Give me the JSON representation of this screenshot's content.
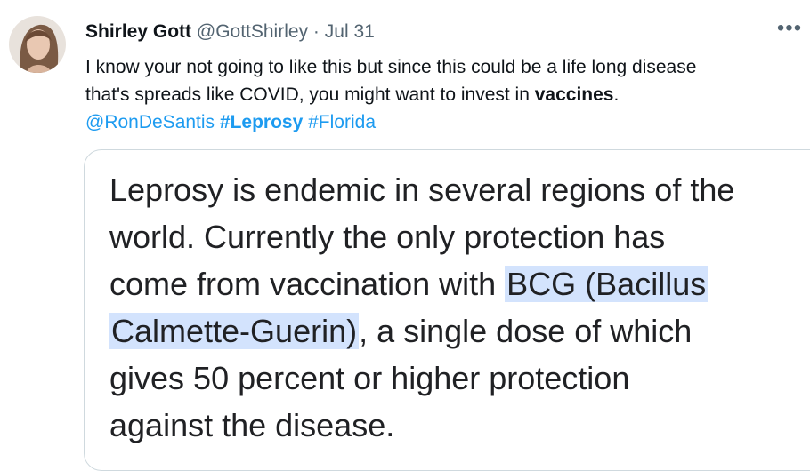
{
  "tweet": {
    "author_name": "Shirley Gott",
    "handle": "@GottShirley",
    "separator": "·",
    "date": "Jul 31",
    "more_icon": "more-horizontal-icon",
    "text_line1": "I know your not going to like this but since this could be a life long disease",
    "text_line2_pre": "that's spreads like COVID, you might want to invest in ",
    "text_line2_bold": "vaccines",
    "text_line2_post": ".",
    "mention": "@RonDeSantis",
    "hashtag1": "#Leprosy",
    "hashtag2": "#Florida"
  },
  "card": {
    "line1": "Leprosy is endemic in several regions of the",
    "line2": "world. Currently the only protection has",
    "line3_pre": "come from vaccination with ",
    "line3_hl": "BCG (Bacillus",
    "line4_hl": "Calmette-Guerin)",
    "line4_post": ", a single dose of which",
    "line5": "gives 50 percent or higher protection",
    "line6": "against the disease."
  },
  "colors": {
    "link": "#1d9bf0",
    "highlight": "#d3e3fd",
    "muted": "#536471"
  }
}
